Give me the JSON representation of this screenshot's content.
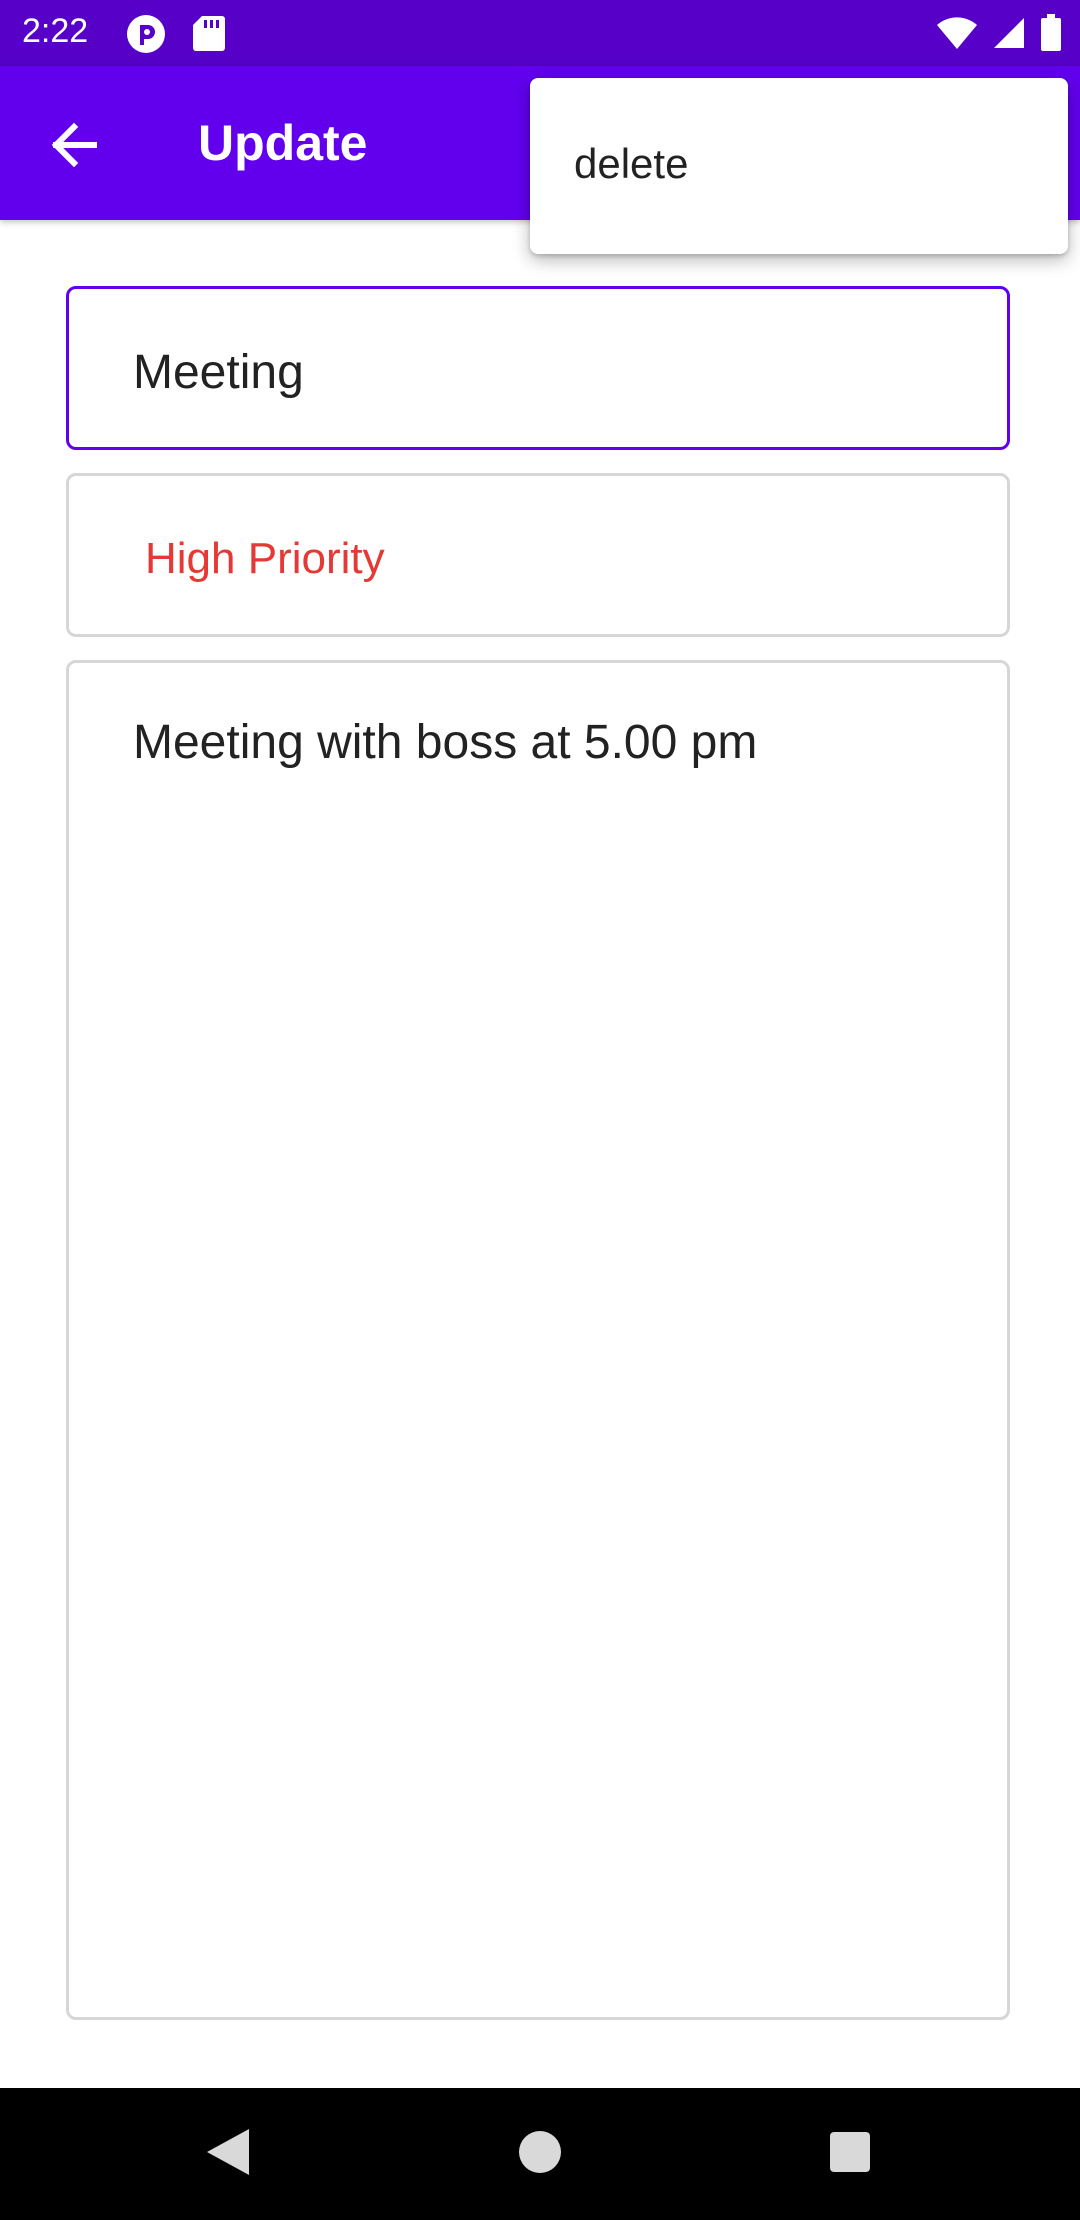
{
  "status_bar": {
    "time": "2:22",
    "icons": [
      "pocket-casts-icon",
      "sd-card-icon",
      "wifi-icon",
      "cell-signal-icon",
      "battery-icon"
    ]
  },
  "app_bar": {
    "title": "Update",
    "back_icon": "arrow-back-icon",
    "background": "#6200EE",
    "status_background": "#5600C8"
  },
  "form": {
    "title_value": "Meeting",
    "priority_value": "High Priority",
    "priority_color": "#E53935",
    "description_value": "Meeting with boss at 5.00 pm"
  },
  "overflow_menu": {
    "items": [
      {
        "label": "delete"
      }
    ]
  },
  "nav_bar": {
    "buttons": [
      "back-triangle-icon",
      "home-circle-icon",
      "recents-square-icon"
    ]
  }
}
